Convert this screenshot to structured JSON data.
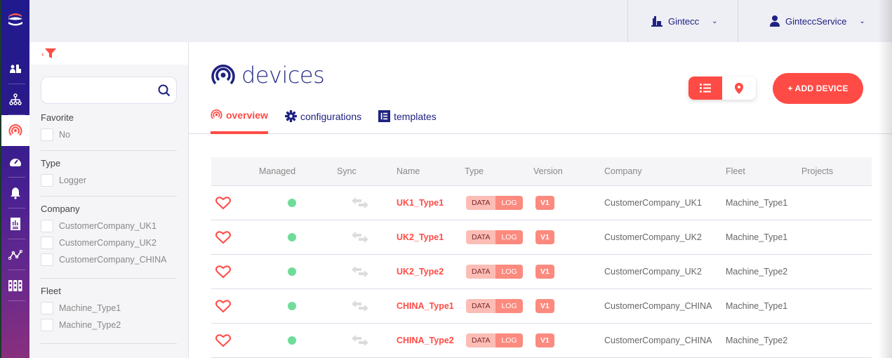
{
  "nav": {
    "items": [
      {
        "id": "companies",
        "icon": "building-users-icon"
      },
      {
        "id": "hierarchy",
        "icon": "sitemap-icon"
      },
      {
        "id": "devices",
        "icon": "broadcast-icon",
        "active": true
      },
      {
        "id": "dashboard",
        "icon": "gauge-icon"
      },
      {
        "id": "alerts",
        "icon": "bell-icon"
      },
      {
        "id": "reports",
        "icon": "report-icon"
      },
      {
        "id": "analytics",
        "icon": "line-chart-icon"
      },
      {
        "id": "storage",
        "icon": "binders-icon"
      }
    ]
  },
  "topbar": {
    "company": "Gintecc",
    "user": "GinteccService"
  },
  "filters": {
    "search": {
      "value": "",
      "placeholder": ""
    },
    "groups": [
      {
        "title": "Favorite",
        "options": [
          "No"
        ]
      },
      {
        "title": "Type",
        "options": [
          "Logger"
        ]
      },
      {
        "title": "Company",
        "options": [
          "CustomerCompany_UK1",
          "CustomerCompany_UK2",
          "CustomerCompany_CHINA"
        ]
      },
      {
        "title": "Fleet",
        "options": [
          "Machine_Type1",
          "Machine_Type2"
        ]
      }
    ]
  },
  "page": {
    "title": "devices",
    "tabs": [
      {
        "label": "overview",
        "icon": "broadcast-icon",
        "active": true
      },
      {
        "label": "configurations",
        "icon": "gear-icon"
      },
      {
        "label": "templates",
        "icon": "list-box-icon"
      }
    ],
    "view_modes": [
      "list",
      "map"
    ],
    "active_view": "list",
    "add_button": "+ ADD DEVICE"
  },
  "colors": {
    "accent": "#ff4b45",
    "navy": "#1f2280",
    "status_ok": "#6fdc9a"
  },
  "table": {
    "columns": [
      "",
      "Managed",
      "Sync",
      "Name",
      "Type",
      "Version",
      "Company",
      "Fleet",
      "Projects"
    ],
    "rows": [
      {
        "favorite": false,
        "managed": true,
        "name": "UK1_Type1",
        "type": [
          "DATA",
          "LOG"
        ],
        "version": "V1",
        "company": "CustomerCompany_UK1",
        "fleet": "Machine_Type1",
        "projects": ""
      },
      {
        "favorite": false,
        "managed": true,
        "name": "UK2_Type1",
        "type": [
          "DATA",
          "LOG"
        ],
        "version": "V1",
        "company": "CustomerCompany_UK2",
        "fleet": "Machine_Type1",
        "projects": ""
      },
      {
        "favorite": false,
        "managed": true,
        "name": "UK2_Type2",
        "type": [
          "DATA",
          "LOG"
        ],
        "version": "V1",
        "company": "CustomerCompany_UK2",
        "fleet": "Machine_Type2",
        "projects": ""
      },
      {
        "favorite": false,
        "managed": true,
        "name": "CHINA_Type1",
        "type": [
          "DATA",
          "LOG"
        ],
        "version": "V1",
        "company": "CustomerCompany_CHINA",
        "fleet": "Machine_Type1",
        "projects": ""
      },
      {
        "favorite": false,
        "managed": true,
        "name": "CHINA_Type2",
        "type": [
          "DATA",
          "LOG"
        ],
        "version": "V1",
        "company": "CustomerCompany_CHINA",
        "fleet": "Machine_Type2",
        "projects": ""
      }
    ]
  }
}
